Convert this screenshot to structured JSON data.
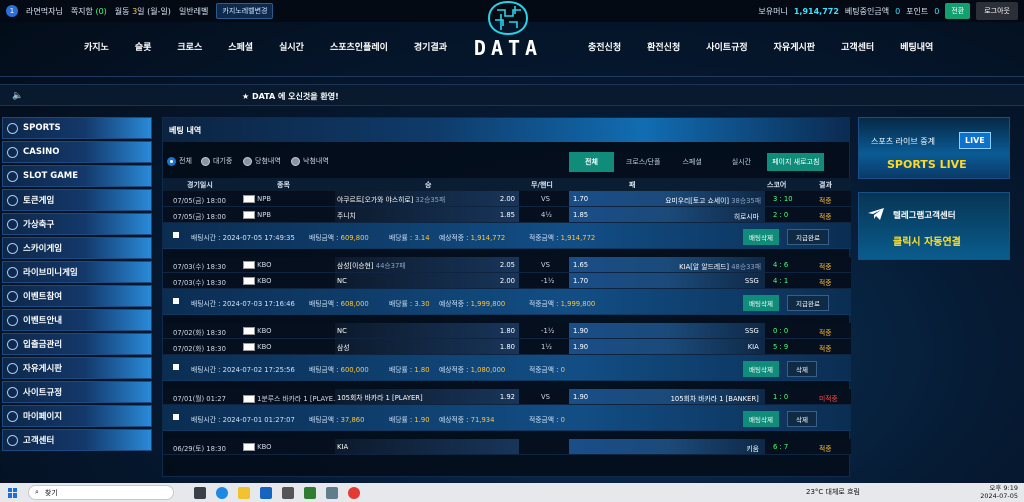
{
  "topbar": {
    "level": "1",
    "rank": "라면먹자님",
    "note_label": "쪽지함",
    "note_count": "(0)",
    "visit_prefix": "월동",
    "visit_count": "3",
    "visit_suffix": "일 (월-일)",
    "normal_level": "일반레벨",
    "casino_btn": "카지노레벨변경",
    "money_label": "보유머니",
    "money_value": "1,914,772",
    "bet_label": "베팅중인금액",
    "bet_value": "0",
    "point_label": "포인트",
    "point_value": "0",
    "convert": "전환",
    "logout": "로그아웃"
  },
  "nav_left": [
    "카지노",
    "슬롯",
    "크로스",
    "스페셜",
    "실시간",
    "스포츠인플레이",
    "경기결과"
  ],
  "nav_right": [
    "충전신청",
    "환전신청",
    "사이트규정",
    "자유게시판",
    "고객센터",
    "베팅내역"
  ],
  "logo": {
    "word": "DATA"
  },
  "notice": "★ DATA 에 오신것을 환영!",
  "sidebar": [
    {
      "label": "SPORTS",
      "icon": "sports-icon"
    },
    {
      "label": "CASINO",
      "icon": "casino-icon"
    },
    {
      "label": "SLOT GAME",
      "icon": "slot-icon"
    },
    {
      "label": "토큰게임",
      "icon": "token-icon"
    },
    {
      "label": "가상축구",
      "icon": "trophy-icon"
    },
    {
      "label": "스카이게임",
      "icon": "sky-icon"
    },
    {
      "label": "라이브미니게임",
      "icon": "live-icon"
    },
    {
      "label": "이벤트참여",
      "icon": "event-icon"
    },
    {
      "label": "이벤트안내",
      "icon": "event-info-icon"
    },
    {
      "label": "입출금관리",
      "icon": "money-icon"
    },
    {
      "label": "자유게시판",
      "icon": "board-icon"
    },
    {
      "label": "사이트규정",
      "icon": "rules-icon"
    },
    {
      "label": "마이페이지",
      "icon": "user-icon"
    },
    {
      "label": "고객센터",
      "icon": "support-icon"
    }
  ],
  "main": {
    "title": "베팅 내역",
    "filters": [
      "전체",
      "대기중",
      "당첨내역",
      "낙첨내역"
    ],
    "tabs": [
      "전체",
      "크로스/단폴",
      "스페셜",
      "실시간",
      "페이지 새로고침"
    ],
    "headers": [
      "경기일시",
      "종목",
      "승",
      "무/핸디",
      "패",
      "스코어",
      "결과"
    ],
    "groups": [
      {
        "rows": [
          {
            "date": "07/05(금) 18:00",
            "league": "NPB",
            "home": "야쿠르트[오가와 야스히로]",
            "home_sub": "32승35패",
            "home_odd": "2.00",
            "mid": "VS",
            "away_odd": "1.70",
            "away": "요미우리[토고 쇼세이]",
            "away_sub": "38승35패",
            "score": "3 : 10",
            "result": "적중"
          },
          {
            "date": "07/05(금) 18:00",
            "league": "NPB",
            "home": "주니치",
            "home_sub": "",
            "home_odd": "1.85",
            "mid": "4½",
            "away_odd": "1.85",
            "away": "히로시마",
            "away_sub": "",
            "score": "2 : 0",
            "result": "적중"
          }
        ],
        "summary": {
          "time_label": "배팅시간 :",
          "time": "2024-07-05 17:49:35",
          "amt_label": "배팅금액 :",
          "amt": "609,800",
          "rate_label": "배당률 :",
          "rate": "3.14",
          "exp_label": "예상적중 :",
          "exp": "1,914,772",
          "hit_label": "적중금액 :",
          "hit": "1,914,772",
          "b1": "배팅삭제",
          "b2": "지급완료"
        }
      },
      {
        "rows": [
          {
            "date": "07/03(수) 18:30",
            "league": "KBO",
            "home": "삼성[이승현]",
            "home_sub": "44승37패",
            "home_odd": "2.05",
            "mid": "VS",
            "away_odd": "1.65",
            "away": "KIA[알 알드레드]",
            "away_sub": "48승33패",
            "score": "4 : 6",
            "result": "적중"
          },
          {
            "date": "07/03(수) 18:30",
            "league": "KBO",
            "home": "NC",
            "home_sub": "",
            "home_odd": "2.00",
            "mid": "-1½",
            "away_odd": "1.70",
            "away": "SSG",
            "away_sub": "",
            "score": "4 : 1",
            "result": "적중"
          }
        ],
        "summary": {
          "time_label": "배팅시간 :",
          "time": "2024-07-03 17:16:46",
          "amt_label": "배팅금액 :",
          "amt": "608,000",
          "rate_label": "배당률 :",
          "rate": "3.30",
          "exp_label": "예상적중 :",
          "exp": "1,999,800",
          "hit_label": "적중금액 :",
          "hit": "1,999,800",
          "b1": "배팅삭제",
          "b2": "지급완료"
        }
      },
      {
        "rows": [
          {
            "date": "07/02(화) 18:30",
            "league": "KBO",
            "home": "NC",
            "home_sub": "",
            "home_odd": "1.80",
            "mid": "-1½",
            "away_odd": "1.90",
            "away": "SSG",
            "away_sub": "",
            "score": "0 : 0",
            "result": "적중"
          },
          {
            "date": "07/02(화) 18:30",
            "league": "KBO",
            "home": "삼성",
            "home_sub": "",
            "home_odd": "1.80",
            "mid": "1½",
            "away_odd": "1.90",
            "away": "KIA",
            "away_sub": "",
            "score": "5 : 9",
            "result": "적중"
          }
        ],
        "summary": {
          "time_label": "배팅시간 :",
          "time": "2024-07-02 17:25:56",
          "amt_label": "배팅금액 :",
          "amt": "600,000",
          "rate_label": "배당률 :",
          "rate": "1.80",
          "exp_label": "예상적중 :",
          "exp": "1,080,000",
          "hit_label": "적중금액 :",
          "hit": "0",
          "b1": "배팅삭제",
          "b2": "삭제"
        }
      },
      {
        "rows": [
          {
            "date": "07/01(월) 01:27",
            "league": "1분루스 바카라 1 [PLAYE...",
            "home": "105회차 바카라 1 [PLAYER]",
            "home_sub": "",
            "home_odd": "1.92",
            "mid": "VS",
            "away_odd": "1.90",
            "away": "105회차 바카라 1 [BANKER]",
            "away_sub": "",
            "score": "1 : 0",
            "result": "미적중"
          }
        ],
        "summary": {
          "time_label": "배팅시간 :",
          "time": "2024-07-01 01:27:07",
          "amt_label": "배팅금액 :",
          "amt": "37,860",
          "rate_label": "배당률 :",
          "rate": "1.90",
          "exp_label": "예상적중 :",
          "exp": "71,934",
          "hit_label": "적중금액 :",
          "hit": "0",
          "b1": "배팅삭제",
          "b2": "삭제"
        }
      },
      {
        "rows": [
          {
            "date": "06/29(토) 18:30",
            "league": "KBO",
            "home": "KIA",
            "home_sub": "",
            "home_odd": "",
            "mid": "",
            "away_odd": "",
            "away": "키움",
            "away_sub": "",
            "score": "6 : 7",
            "result": "적중"
          }
        ]
      }
    ]
  },
  "banners": {
    "b1_t1": "스포츠 라이브 중계",
    "b1_live": "LIVE",
    "b1_t2": "SPORTS LIVE",
    "b2_t1": "텔레그램고객센터",
    "b2_t2": "클릭시 자동연결"
  },
  "taskbar": {
    "search": "찾기",
    "weather": "23°C 대체로 흐림",
    "time": "오후 9:19",
    "date": "2024-07-05"
  }
}
